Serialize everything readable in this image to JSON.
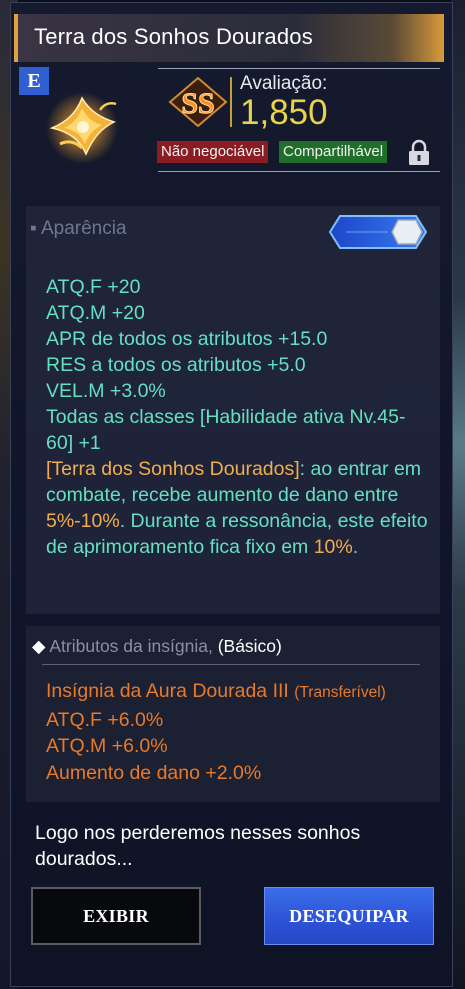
{
  "item": {
    "title": "Terra dos Sonhos Dourados",
    "grade": "E",
    "icon": "golden-wing-emblem-icon"
  },
  "rating": {
    "rank": "SS",
    "label": "Avaliação:",
    "value": "1,850"
  },
  "tags": {
    "trade": "Não negociável",
    "share": "Compartilhável",
    "lock_icon": "lock-icon"
  },
  "appearance": {
    "header": "Aparência",
    "toggle_on": true
  },
  "stats": [
    {
      "text": "ATQ.F +20"
    },
    {
      "text": "ATQ.M +20"
    },
    {
      "text": "APR de todos os atributos +15.0"
    },
    {
      "text": "RES a todos os atributos +5.0"
    },
    {
      "text": "VEL.M +3.0%"
    },
    {
      "text": "Todas as classes [Habilidade ativa Nv.45-60] +1"
    }
  ],
  "effect": {
    "name": "[Terra dos Sonhos Dourados]",
    "part1": ": ao entrar em combate, recebe aumento de dano entre ",
    "range": "5%-10%",
    "part2": ". Durante a ressonância, este efeito de aprimoramento fica fixo em ",
    "fixed": "10%",
    "part3": "."
  },
  "insignia": {
    "header_label": "Atributos da insígnia,",
    "header_basic": "(Básico)",
    "name": "Insígnia da Aura Dourada III",
    "transfer": "(Transferível)",
    "stats": [
      "ATQ.F +6.0%",
      "ATQ.M +6.0%",
      "Aumento de dano +2.0%"
    ]
  },
  "flavor_text": "Logo nos perderemos nesses sonhos dourados...",
  "buttons": {
    "show": "EXIBIR",
    "unequip": "DESEQUIPAR"
  },
  "colors": {
    "stat_teal": "#64e0c2",
    "highlight_orange": "#f2ae4c",
    "insignia_orange": "#e87a28",
    "rating_yellow": "#e8d44a",
    "grade_blue": "#2f5fd0",
    "tag_red": "#8a1c24",
    "tag_green": "#1f6f2a"
  }
}
